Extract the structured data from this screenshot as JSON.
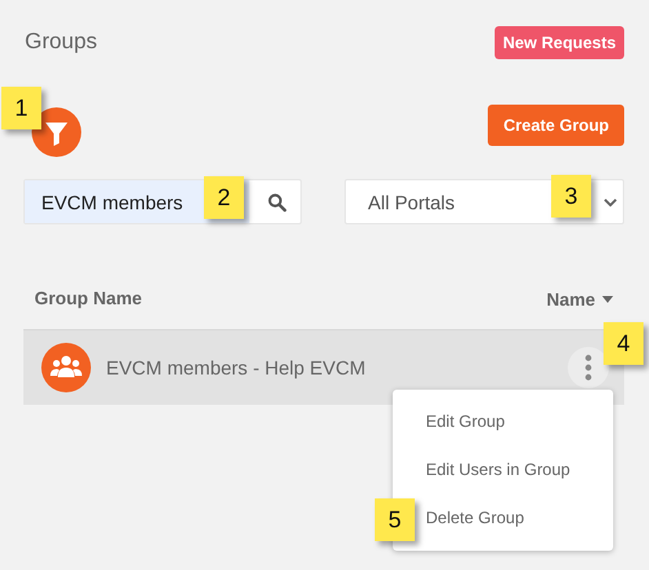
{
  "title": "Groups",
  "new_requests_button": "New Requests",
  "create_group_button": "Create Group",
  "search": {
    "value": "EVCM members"
  },
  "portal_select": {
    "value": "All Portals"
  },
  "table": {
    "columns": [
      "Group Name"
    ],
    "sort": {
      "label": "Name"
    },
    "rows": [
      {
        "name": "EVCM members - Help EVCM"
      }
    ]
  },
  "row_menu": {
    "items": [
      "Edit Group",
      "Edit Users in Group",
      "Delete Group"
    ]
  },
  "callouts": [
    "1",
    "2",
    "3",
    "4",
    "5"
  ]
}
